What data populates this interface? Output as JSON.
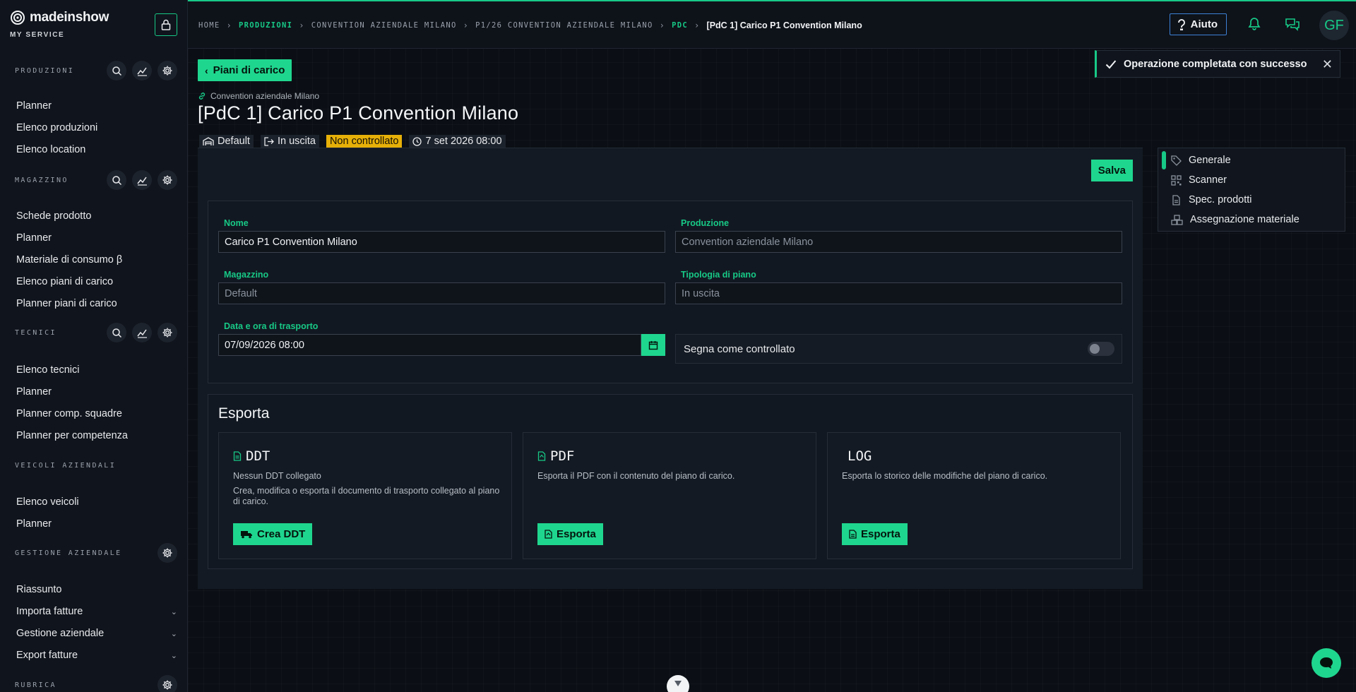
{
  "colors": {
    "accent": "#1fd68f",
    "warning": "#e7b008",
    "help_border": "#3c82d6",
    "background": "#0b0f15"
  },
  "brand": {
    "logo_text": "madeinshow",
    "subtitle": "MY SERVICE"
  },
  "sidebar": {
    "sections": [
      {
        "title": "PRODUZIONI",
        "icons": [
          "search-icon",
          "chart-icon",
          "gear-icon"
        ],
        "items": [
          "Planner",
          "Elenco produzioni",
          "Elenco location"
        ]
      },
      {
        "title": "MAGAZZINO",
        "icons": [
          "search-icon",
          "chart-icon",
          "gear-icon"
        ],
        "items": [
          "Schede prodotto",
          "Planner",
          "Materiale di consumo β",
          "Elenco piani di carico",
          "Planner piani di carico"
        ]
      },
      {
        "title": "TECNICI",
        "icons": [
          "search-icon",
          "chart-icon",
          "gear-icon"
        ],
        "items": [
          "Elenco tecnici",
          "Planner",
          "Planner comp. squadre",
          "Planner per competenza"
        ]
      },
      {
        "title": "VEICOLI AZIENDALI",
        "icons": [],
        "items": [
          "Elenco veicoli",
          "Planner"
        ]
      },
      {
        "title": "GESTIONE AZIENDALE",
        "icons": [
          "gear-icon"
        ],
        "items": [
          "Riassunto",
          "Importa fatture",
          "Gestione aziendale",
          "Export fatture"
        ]
      },
      {
        "title": "RUBRICA",
        "icons": [
          "gear-icon"
        ],
        "items": []
      }
    ]
  },
  "breadcrumb": [
    "HOME",
    "PRODUZIONI",
    "CONVENTION AZIENDALE MILANO",
    "P1/26 CONVENTION AZIENDALE MILANO",
    "PDC",
    "[PdC 1] Carico P1 Convention Milano"
  ],
  "header": {
    "help_label": "Aiuto",
    "avatar_initials": "GF"
  },
  "toast": {
    "message": "Operazione completata con successo"
  },
  "page": {
    "back_label": "Piani di carico",
    "production_ref": "Convention aziendale Milano",
    "title": "[PdC 1] Carico P1 Convention Milano",
    "tags": {
      "warehouse": "Default",
      "direction": "In uscita",
      "status": "Non controllato",
      "datetime": "7 set 2026 08:00"
    },
    "save_label": "Salva"
  },
  "form": {
    "name_label": "Nome",
    "name_value": "Carico P1 Convention Milano",
    "production_label": "Produzione",
    "production_placeholder": "Convention aziendale Milano",
    "warehouse_label": "Magazzino",
    "warehouse_placeholder": "Default",
    "plan_type_label": "Tipologia di piano",
    "plan_type_placeholder": "In uscita",
    "transport_label": "Data e ora di trasporto",
    "transport_value": "07/09/2026 08:00",
    "checked_label": "Segna come controllato"
  },
  "export": {
    "title": "Esporta",
    "ddt": {
      "title": "DDT",
      "line1": "Nessun DDT collegato",
      "line2": "Crea, modifica o esporta il documento di trasporto collegato al piano di carico.",
      "button": "Crea DDT"
    },
    "pdf": {
      "title": "PDF",
      "line1": "Esporta il PDF con il contenuto del piano di carico.",
      "button": "Esporta"
    },
    "log": {
      "title": "LOG",
      "line1": "Esporta lo storico delle modifiche del piano di carico.",
      "button": "Esporta"
    }
  },
  "side_menu": [
    "Generale",
    "Scanner",
    "Spec. prodotti",
    "Assegnazione materiale"
  ]
}
